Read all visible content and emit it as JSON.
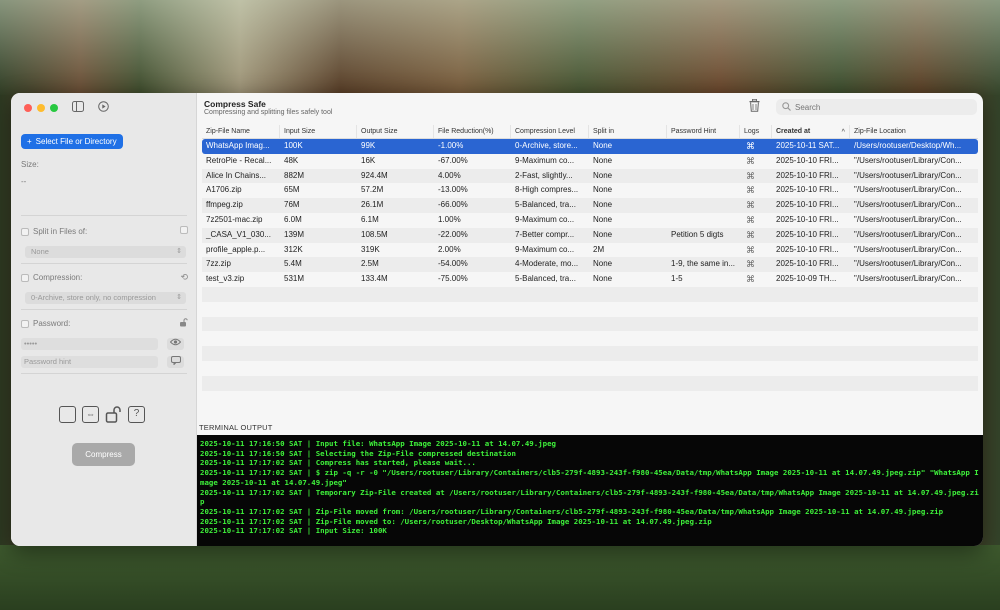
{
  "app": {
    "title": "Compress Safe",
    "subtitle": "Compressing and splitting files safely tool"
  },
  "sidebar": {
    "select_button": "Select File or Directory",
    "size_label": "Size:",
    "size_value": "--",
    "split_label": "Split in Files of:",
    "split_value": "None",
    "compression_label": "Compression:",
    "compression_value": "0-Archive, store only, no compression",
    "password_label": "Password:",
    "password_value": "•••••",
    "password_hint_placeholder": "Password hint",
    "compress_button": "Compress"
  },
  "search": {
    "placeholder": "Search"
  },
  "table": {
    "columns": [
      "Zip-File Name",
      "Input Size",
      "Output Size",
      "File Reduction(%)",
      "Compression Level",
      "Split in",
      "Password Hint",
      "Logs",
      "Created at",
      "Zip-File Location"
    ],
    "rows": [
      [
        "WhatsApp Imag...",
        "100K",
        "99K",
        "-1.00%",
        "0-Archive, store...",
        "None",
        "",
        "⌘",
        "2025-10-11 SAT...",
        "/Users/rootuser/Desktop/Wh..."
      ],
      [
        "RetroPie - Recal...",
        "48K",
        "16K",
        "-67.00%",
        "9-Maximum co...",
        "None",
        "",
        "⌘",
        "2025-10-10 FRI...",
        "\"/Users/rootuser/Library/Con..."
      ],
      [
        "Alice In Chains...",
        "882M",
        "924.4M",
        "4.00%",
        "2-Fast, slightly...",
        "None",
        "",
        "⌘",
        "2025-10-10 FRI...",
        "\"/Users/rootuser/Library/Con..."
      ],
      [
        "A1706.zip",
        "65M",
        "57.2M",
        "-13.00%",
        "8-High compres...",
        "None",
        "",
        "⌘",
        "2025-10-10 FRI...",
        "\"/Users/rootuser/Library/Con..."
      ],
      [
        "ffmpeg.zip",
        "76M",
        "26.1M",
        "-66.00%",
        "5-Balanced, tra...",
        "None",
        "",
        "⌘",
        "2025-10-10 FRI...",
        "\"/Users/rootuser/Library/Con..."
      ],
      [
        "7z2501-mac.zip",
        "6.0M",
        "6.1M",
        "1.00%",
        "9-Maximum co...",
        "None",
        "",
        "⌘",
        "2025-10-10 FRI...",
        "\"/Users/rootuser/Library/Con..."
      ],
      [
        "_CASA_V1_030...",
        "139M",
        "108.5M",
        "-22.00%",
        "7-Better compr...",
        "None",
        "Petition 5 digts",
        "⌘",
        "2025-10-10 FRI...",
        "\"/Users/rootuser/Library/Con..."
      ],
      [
        "profile_apple.p...",
        "312K",
        "319K",
        "2.00%",
        "9-Maximum co...",
        "2M",
        "",
        "⌘",
        "2025-10-10 FRI...",
        "\"/Users/rootuser/Library/Con..."
      ],
      [
        "7zz.zip",
        "5.4M",
        "2.5M",
        "-54.00%",
        "4-Moderate, mo...",
        "None",
        "1-9, the same in...",
        "⌘",
        "2025-10-10 FRI...",
        "\"/Users/rootuser/Library/Con..."
      ],
      [
        "test_v3.zip",
        "531M",
        "133.4M",
        "-75.00%",
        "5-Balanced, tra...",
        "None",
        "1-5",
        "⌘",
        "2025-10-09 TH...",
        "\"/Users/rootuser/Library/Con..."
      ]
    ]
  },
  "terminal": {
    "label": "TERMINAL OUTPUT",
    "lines": [
      "2025-10-11 17:16:50 SAT | Input file: WhatsApp Image 2025-10-11 at 14.07.49.jpeg",
      "2025-10-11 17:16:50 SAT | Selecting the Zip-File compressed destination",
      "2025-10-11 17:17:02 SAT | Compress has started, please wait...",
      "2025-10-11 17:17:02 SAT | $ zip -q -r -0 \"/Users/rootuser/Library/Containers/clb5-279f-4893-243f-f980-45ea/Data/tmp/WhatsApp Image 2025-10-11 at 14.07.49.jpeg.zip\" \"WhatsApp Image 2025-10-11 at 14.07.49.jpeg\"",
      "2025-10-11 17:17:02 SAT | Temporary Zip-File created at /Users/rootuser/Library/Containers/clb5-279f-4893-243f-f980-45ea/Data/tmp/WhatsApp Image 2025-10-11 at 14.07.49.jpeg.zip",
      "2025-10-11 17:17:02 SAT | Zip-File moved from: /Users/rootuser/Library/Containers/clb5-279f-4893-243f-f980-45ea/Data/tmp/WhatsApp Image 2025-10-11 at 14.07.49.jpeg.zip",
      "2025-10-11 17:17:02 SAT | Zip-File moved to: /Users/rootuser/Desktop/WhatsApp Image 2025-10-11 at 14.07.49.jpeg.zip",
      "2025-10-11 17:17:02 SAT | Input Size: 100K"
    ]
  },
  "colors": {
    "accent": "#1f70e6",
    "selection": "#2a65d2",
    "terminal_bg": "#060606",
    "terminal_text": "#3ef03a"
  }
}
